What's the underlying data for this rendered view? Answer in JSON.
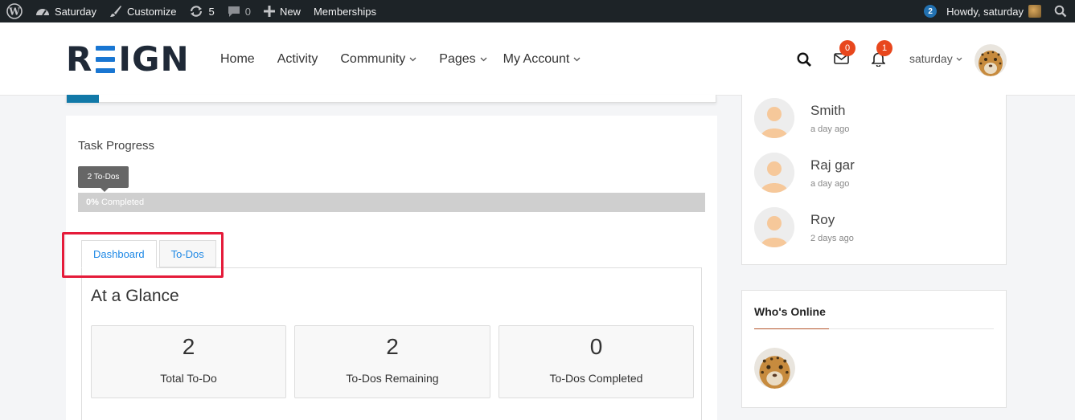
{
  "adminbar": {
    "site_name": "Saturday",
    "customize": "Customize",
    "updates_count": "5",
    "comments_count": "0",
    "new_label": "New",
    "memberships": "Memberships",
    "notif_count": "2",
    "howdy": "Howdy, saturday"
  },
  "header": {
    "logo_pre": "R",
    "logo_post": "IGN",
    "nav": [
      {
        "label": "Home"
      },
      {
        "label": "Activity"
      },
      {
        "label": "Community"
      },
      {
        "label": "Pages"
      },
      {
        "label": "My Account"
      }
    ],
    "messages_count": "0",
    "notifications_count": "1",
    "username": "saturday"
  },
  "task": {
    "title": "Task Progress",
    "tooltip": "2 To-Dos",
    "percent_label": "0%",
    "completed_label": " Completed",
    "progress_fraction": 0
  },
  "tabs": [
    {
      "label": "Dashboard",
      "active": true
    },
    {
      "label": "To-Dos",
      "active": false
    }
  ],
  "glance": {
    "title": "At a Glance",
    "stats": [
      {
        "value": "2",
        "label": "Total To-Do"
      },
      {
        "value": "2",
        "label": "To-Dos Remaining"
      },
      {
        "value": "0",
        "label": "To-Dos Completed"
      }
    ]
  },
  "members": [
    {
      "name": "Smith",
      "time": "a day ago"
    },
    {
      "name": "Raj gar",
      "time": "a day ago"
    },
    {
      "name": "Roy",
      "time": "2 days ago"
    }
  ],
  "who_online": {
    "title": "Who's Online"
  },
  "colors": {
    "accent_blue": "#1976d2",
    "badge_orange": "#e8471d",
    "highlight_red": "#e51b3a"
  }
}
